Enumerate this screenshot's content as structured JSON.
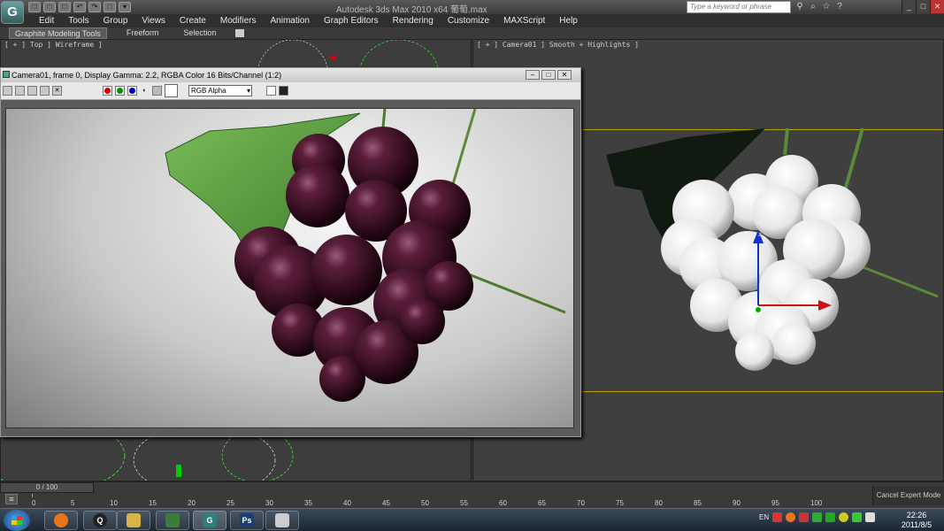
{
  "app": {
    "logo_glyph": "G",
    "title": "Autodesk 3ds Max 2010 x64      葡萄.max"
  },
  "quick_access": [
    "□",
    "□",
    "□",
    "↶",
    "↷",
    "□",
    "▾"
  ],
  "search": {
    "placeholder": "Type a keyword or phrase"
  },
  "search_icons": [
    "⚲",
    "⌕",
    "☆",
    "?"
  ],
  "window_controls": {
    "minimize": "_",
    "maximize": "□",
    "close": "✕"
  },
  "menu": [
    "Edit",
    "Tools",
    "Group",
    "Views",
    "Create",
    "Modifiers",
    "Animation",
    "Graph Editors",
    "Rendering",
    "Customize",
    "MAXScript",
    "Help"
  ],
  "ribbon": {
    "tabs": [
      "Graphite Modeling Tools",
      "Freeform",
      "Selection"
    ],
    "active": 0
  },
  "viewports": {
    "top_label": "[ + ] Top ] Wireframe ]",
    "camera_label": "[ + ] Camera01 ] Smooth + Highlights ]",
    "axis_x": "x",
    "axis_z": "z"
  },
  "render_window": {
    "title": "Camera01, frame 0, Display Gamma: 2.2, RGBA Color 16 Bits/Channel (1:2)",
    "channel": "RGB Alpha",
    "controls": {
      "minimize": "–",
      "maximize": "□",
      "close": "✕"
    },
    "channel_colors": {
      "red": "#d40000",
      "green": "#009000",
      "blue": "#0000c0"
    }
  },
  "timeline": {
    "current": "0 / 100",
    "ticks": [
      "0",
      "5",
      "10",
      "15",
      "20",
      "25",
      "30",
      "35",
      "40",
      "45",
      "50",
      "55",
      "60",
      "65",
      "70",
      "75",
      "80",
      "85",
      "90",
      "95",
      "100"
    ],
    "cancel_expert": "Cancel Expert Mode"
  },
  "taskbar": {
    "apps": [
      {
        "name": "firefox",
        "glyph": "",
        "color": "#e8741b"
      },
      {
        "name": "qq",
        "glyph": "Q",
        "color": "#222222"
      },
      {
        "name": "file-explorer",
        "glyph": "",
        "color": "#d8b34a"
      },
      {
        "name": "network-app",
        "glyph": "",
        "color": "#3a7d3a"
      },
      {
        "name": "3dsmax",
        "glyph": "G",
        "color": "#2f7f7f"
      },
      {
        "name": "photoshop",
        "glyph": "Ps",
        "color": "#1a3f73"
      },
      {
        "name": "image-viewer",
        "glyph": "",
        "color": "#cccccc"
      }
    ],
    "language": "EN",
    "time": "22:26",
    "date": "2011/8/5"
  }
}
